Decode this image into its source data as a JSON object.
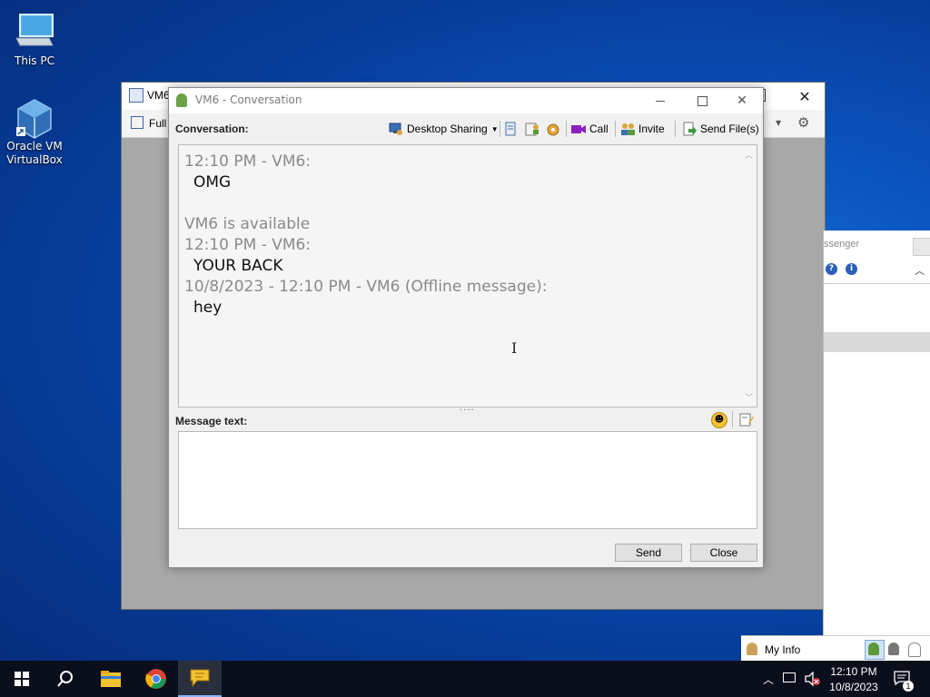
{
  "desktop": {
    "icons": [
      {
        "label": "This PC"
      },
      {
        "label": "Oracle VM VirtualBox"
      }
    ]
  },
  "vbox_window": {
    "title_fragment": "VM6",
    "toolbar_fragment": "Full"
  },
  "messenger_side": {
    "title_fragment": "ssenger",
    "footer_label": "My Info"
  },
  "conversation": {
    "window_title": "VM6 - Conversation",
    "conversation_label": "Conversation:",
    "toolbar": {
      "desktop_sharing": "Desktop Sharing",
      "call": "Call",
      "invite": "Invite",
      "send_files": "Send File(s)"
    },
    "messages": [
      {
        "text": "12:10 PM - VM6:",
        "style": "gray"
      },
      {
        "text": "OMG",
        "style": "black"
      },
      {
        "text": "VM6 is available",
        "style": "gray"
      },
      {
        "text": "12:10 PM - VM6:",
        "style": "gray"
      },
      {
        "text": "YOUR BACK",
        "style": "black"
      },
      {
        "text": "10/8/2023 - 12:10 PM - VM6 (Offline message):",
        "style": "gray"
      },
      {
        "text": "hey",
        "style": "black"
      }
    ],
    "message_text_label": "Message text:",
    "message_input_value": "",
    "send_button": "Send",
    "close_button": "Close"
  },
  "taskbar": {
    "clock_time": "12:10 PM",
    "clock_date": "10/8/2023",
    "notification_count": "1"
  },
  "colors": {
    "desktop_blue": "#0a55c0",
    "taskbar": "#0b0f1c",
    "call_purple": "#8b1fc4"
  }
}
